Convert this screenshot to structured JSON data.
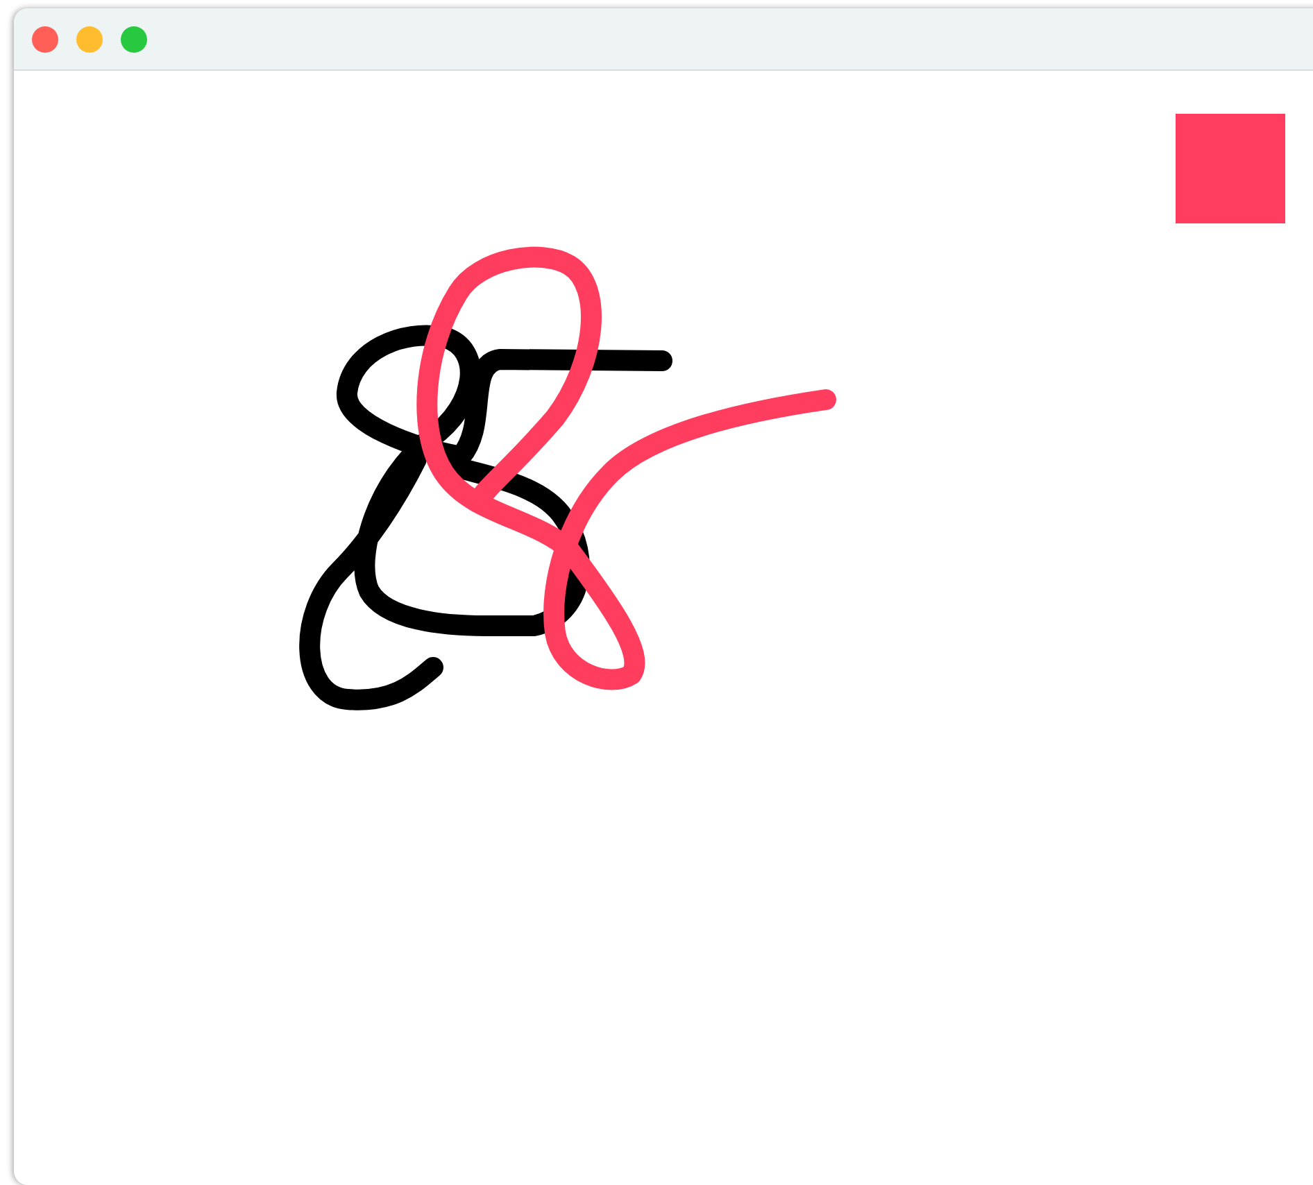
{
  "swatch": {
    "color": "#ff3d5e"
  },
  "strokes": [
    {
      "color": "#000000"
    },
    {
      "color": "#ff3d5e"
    }
  ]
}
